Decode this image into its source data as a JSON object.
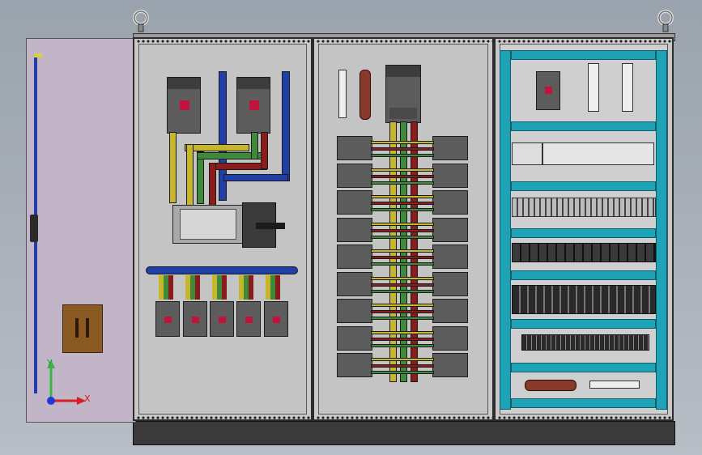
{
  "viewport": {
    "axis": {
      "x_label": "X",
      "y_label": "Y"
    }
  },
  "colors": {
    "background": "#a7aeb6",
    "door": "#c3b5c8",
    "panel": "#c9c9c9",
    "busbar_blue": "#1f3ea8",
    "busbar_yellow": "#c7b62c",
    "busbar_green": "#3f8a3a",
    "busbar_red": "#8a1c1c",
    "din_rail": "#1ea3b6",
    "breaker_handle": "#c0143c"
  },
  "icons": {
    "lifting_eye_left": "lifting-eye-icon",
    "lifting_eye_right": "lifting-eye-icon",
    "axis_triad": "xyz-axis-triad-icon"
  }
}
